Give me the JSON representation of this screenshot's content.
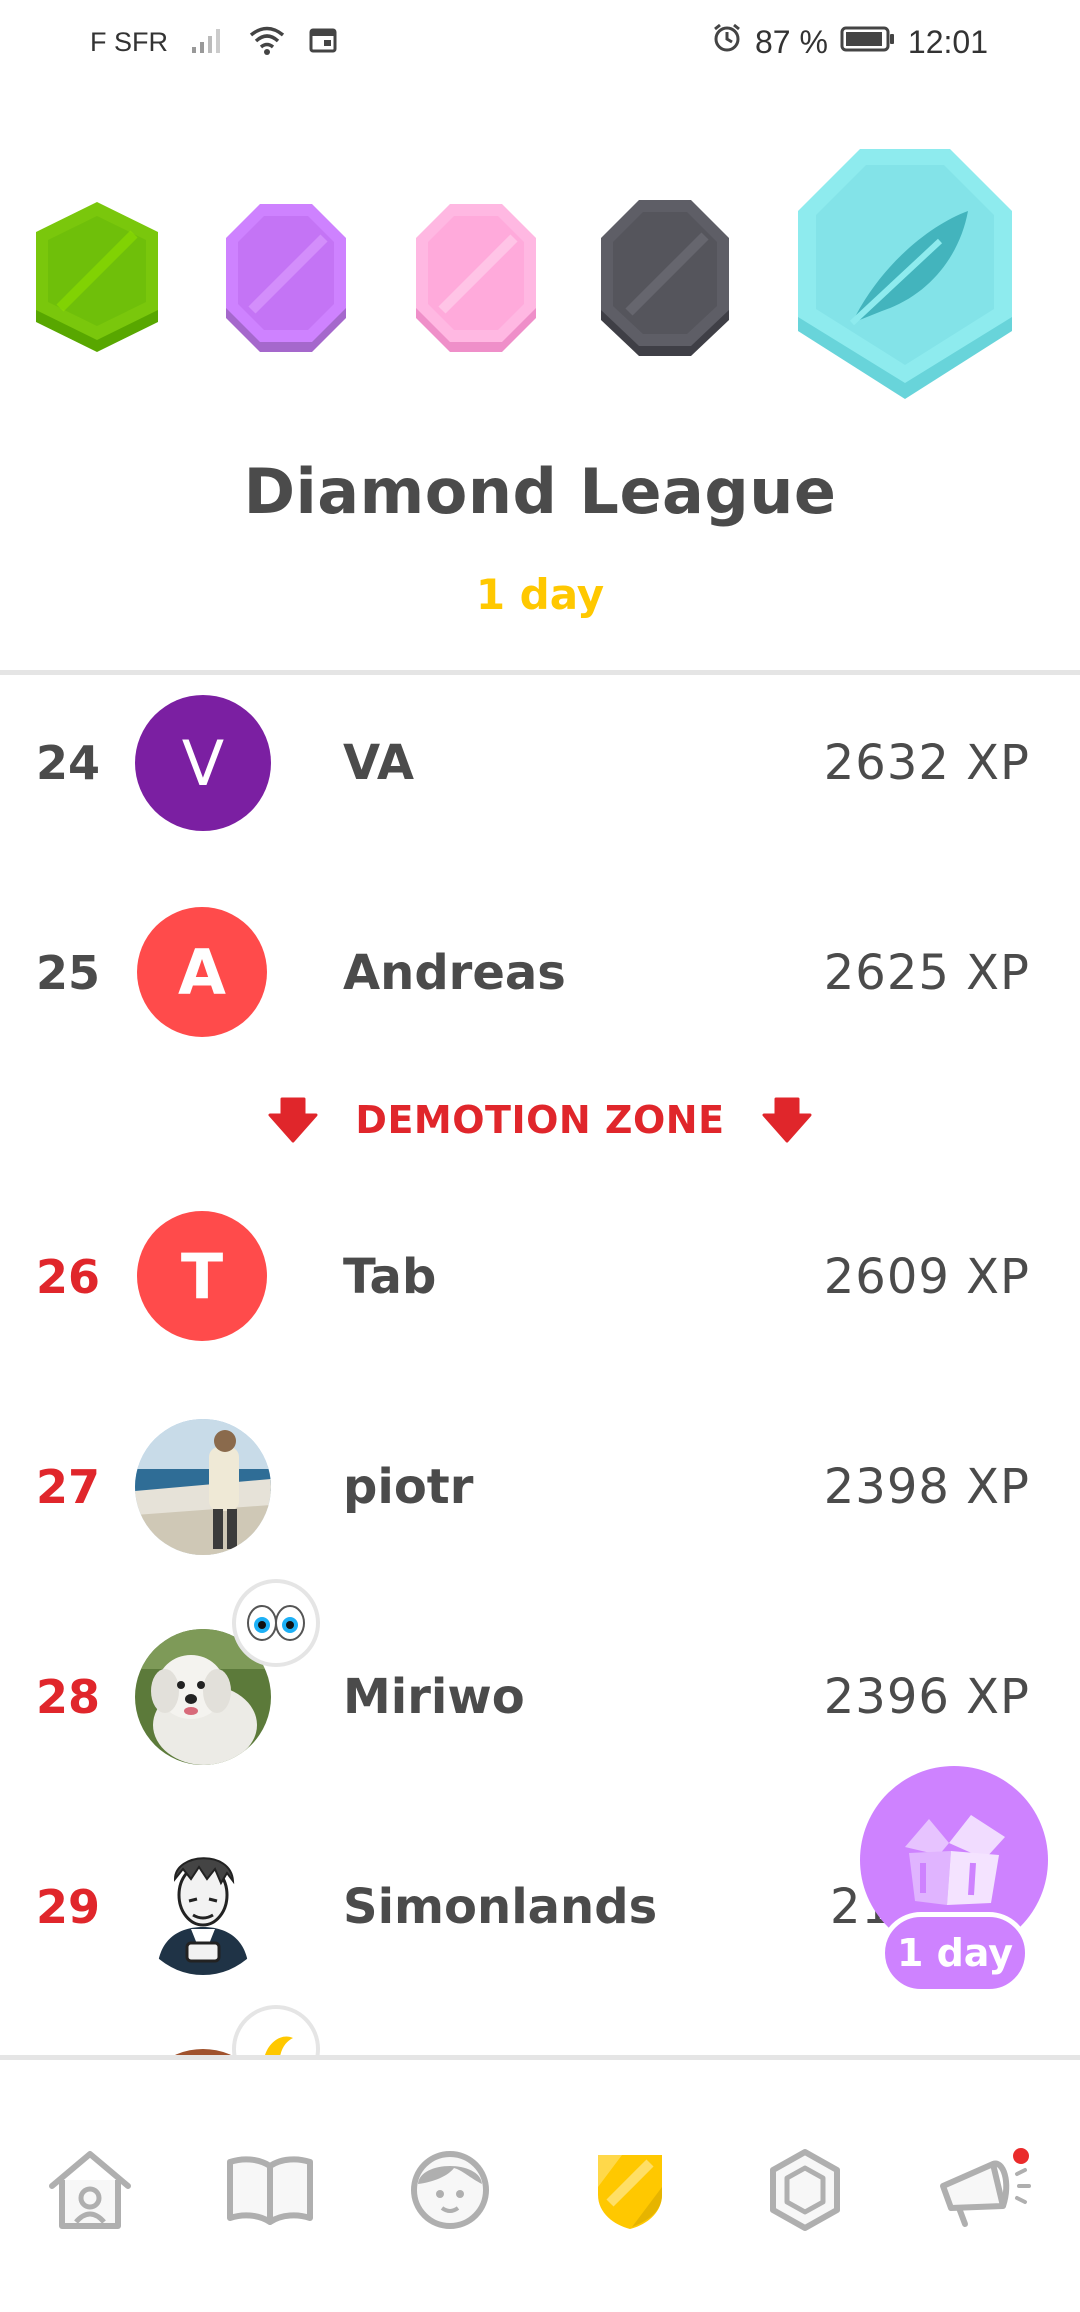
{
  "status_bar": {
    "carrier": "F SFR",
    "battery": "87 %",
    "time": "12:01"
  },
  "league": {
    "title": "Diamond League",
    "time_left": "1 day",
    "badges": [
      {
        "icon": "bronze-league-badge-icon",
        "color": "#7ac70c"
      },
      {
        "icon": "amethyst-league-badge-icon",
        "color": "#ce82ff"
      },
      {
        "icon": "pearl-league-badge-icon",
        "color": "#ffb0e0"
      },
      {
        "icon": "obsidian-league-badge-icon",
        "color": "#5e5e66"
      },
      {
        "icon": "diamond-league-badge-icon",
        "color": "#8de9ec",
        "current": true
      }
    ]
  },
  "leaderboard": {
    "rows": [
      {
        "rank": "24",
        "initial": "V",
        "name": "VA",
        "xp": "2632 XP",
        "avatar_color": "#7b1fa2"
      },
      {
        "rank": "25",
        "initial": "A",
        "name": "Andreas",
        "xp": "2625 XP",
        "avatar_color": "#ff4b4b"
      },
      {
        "rank": "26",
        "initial": "T",
        "name": "Tab",
        "xp": "2609 XP",
        "avatar_color": "#ff4b4b"
      },
      {
        "rank": "27",
        "name": "piotr",
        "xp": "2398 XP",
        "avatar": "photo-avatar"
      },
      {
        "rank": "28",
        "name": "Miriwo",
        "xp": "2396 XP",
        "avatar": "dog-photo-avatar",
        "sticker": "eyes-icon"
      },
      {
        "rank": "29",
        "name": "Simonlands",
        "xp": "21",
        "avatar": "cartoon-avatar"
      }
    ],
    "demotion_label": "DEMOTION ZONE"
  },
  "chest_button": {
    "icon": "treasure-chest-icon",
    "label": "1 day"
  },
  "colors": {
    "accent_gold": "#ffc800",
    "demotion_red": "#e0262b",
    "chest_purple": "#ce82ff"
  },
  "bottom_nav": [
    {
      "icon": "home-icon"
    },
    {
      "icon": "book-icon"
    },
    {
      "icon": "friends-icon"
    },
    {
      "icon": "league-shield-icon",
      "active": true
    },
    {
      "icon": "gem-icon"
    },
    {
      "icon": "megaphone-icon",
      "badge": true
    }
  ]
}
